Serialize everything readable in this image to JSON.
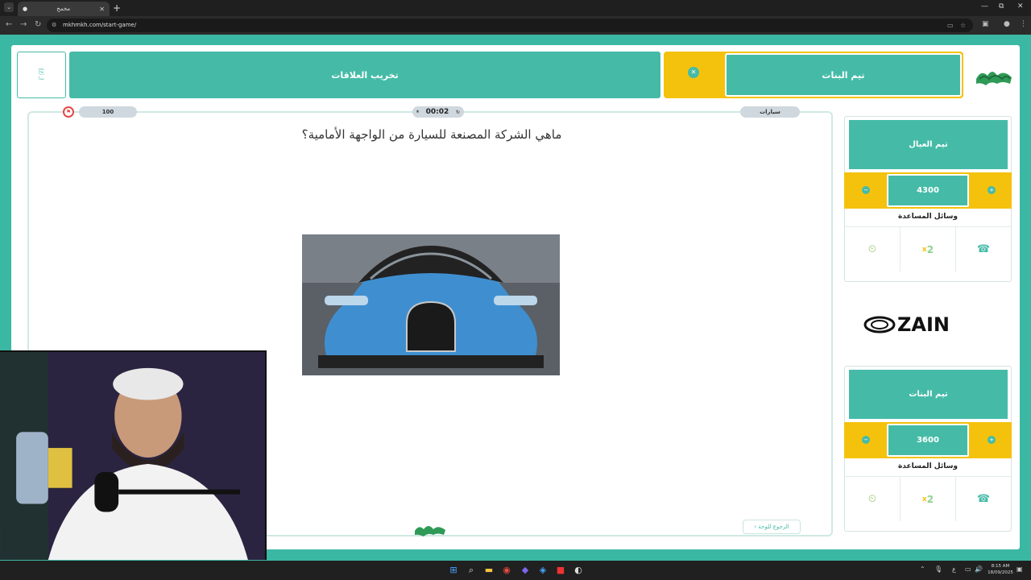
{
  "browser": {
    "tab_title": "مخمخ",
    "tab_close": "✕",
    "new_tab": "+",
    "url": "mkhmkh.com/start-game/",
    "win_min": "—",
    "win_max": "⧉",
    "win_close": "✕"
  },
  "header": {
    "active_team": "تيم البنات",
    "ruin_relationships": "تخريب العلاقات",
    "corner_label": "تبدأ"
  },
  "question_panel": {
    "category": "سيارات",
    "timer": "00:02",
    "points": "100",
    "question": "ماهي الشركة المصنعة للسيارة من الواجهة الأمامية؟",
    "back_button": "الرجوع للوحة"
  },
  "teams": [
    {
      "name": "تيم العيال",
      "score": "4300",
      "aids_title": "وسائل المساعدة",
      "x2": "2",
      "x_mark": "x"
    },
    {
      "name": "تيم البنات",
      "score": "3600",
      "aids_title": "وسائل المساعدة",
      "x2": "2",
      "x_mark": "x"
    }
  ],
  "sponsor": {
    "name": "ZAIN"
  },
  "taskbar": {
    "time": "8:15 AM",
    "date": "18/09/2025",
    "lang": "ع"
  },
  "colors": {
    "teal": "#45bba7",
    "yellow": "#f4c20d",
    "background": "#3bb8a3"
  }
}
